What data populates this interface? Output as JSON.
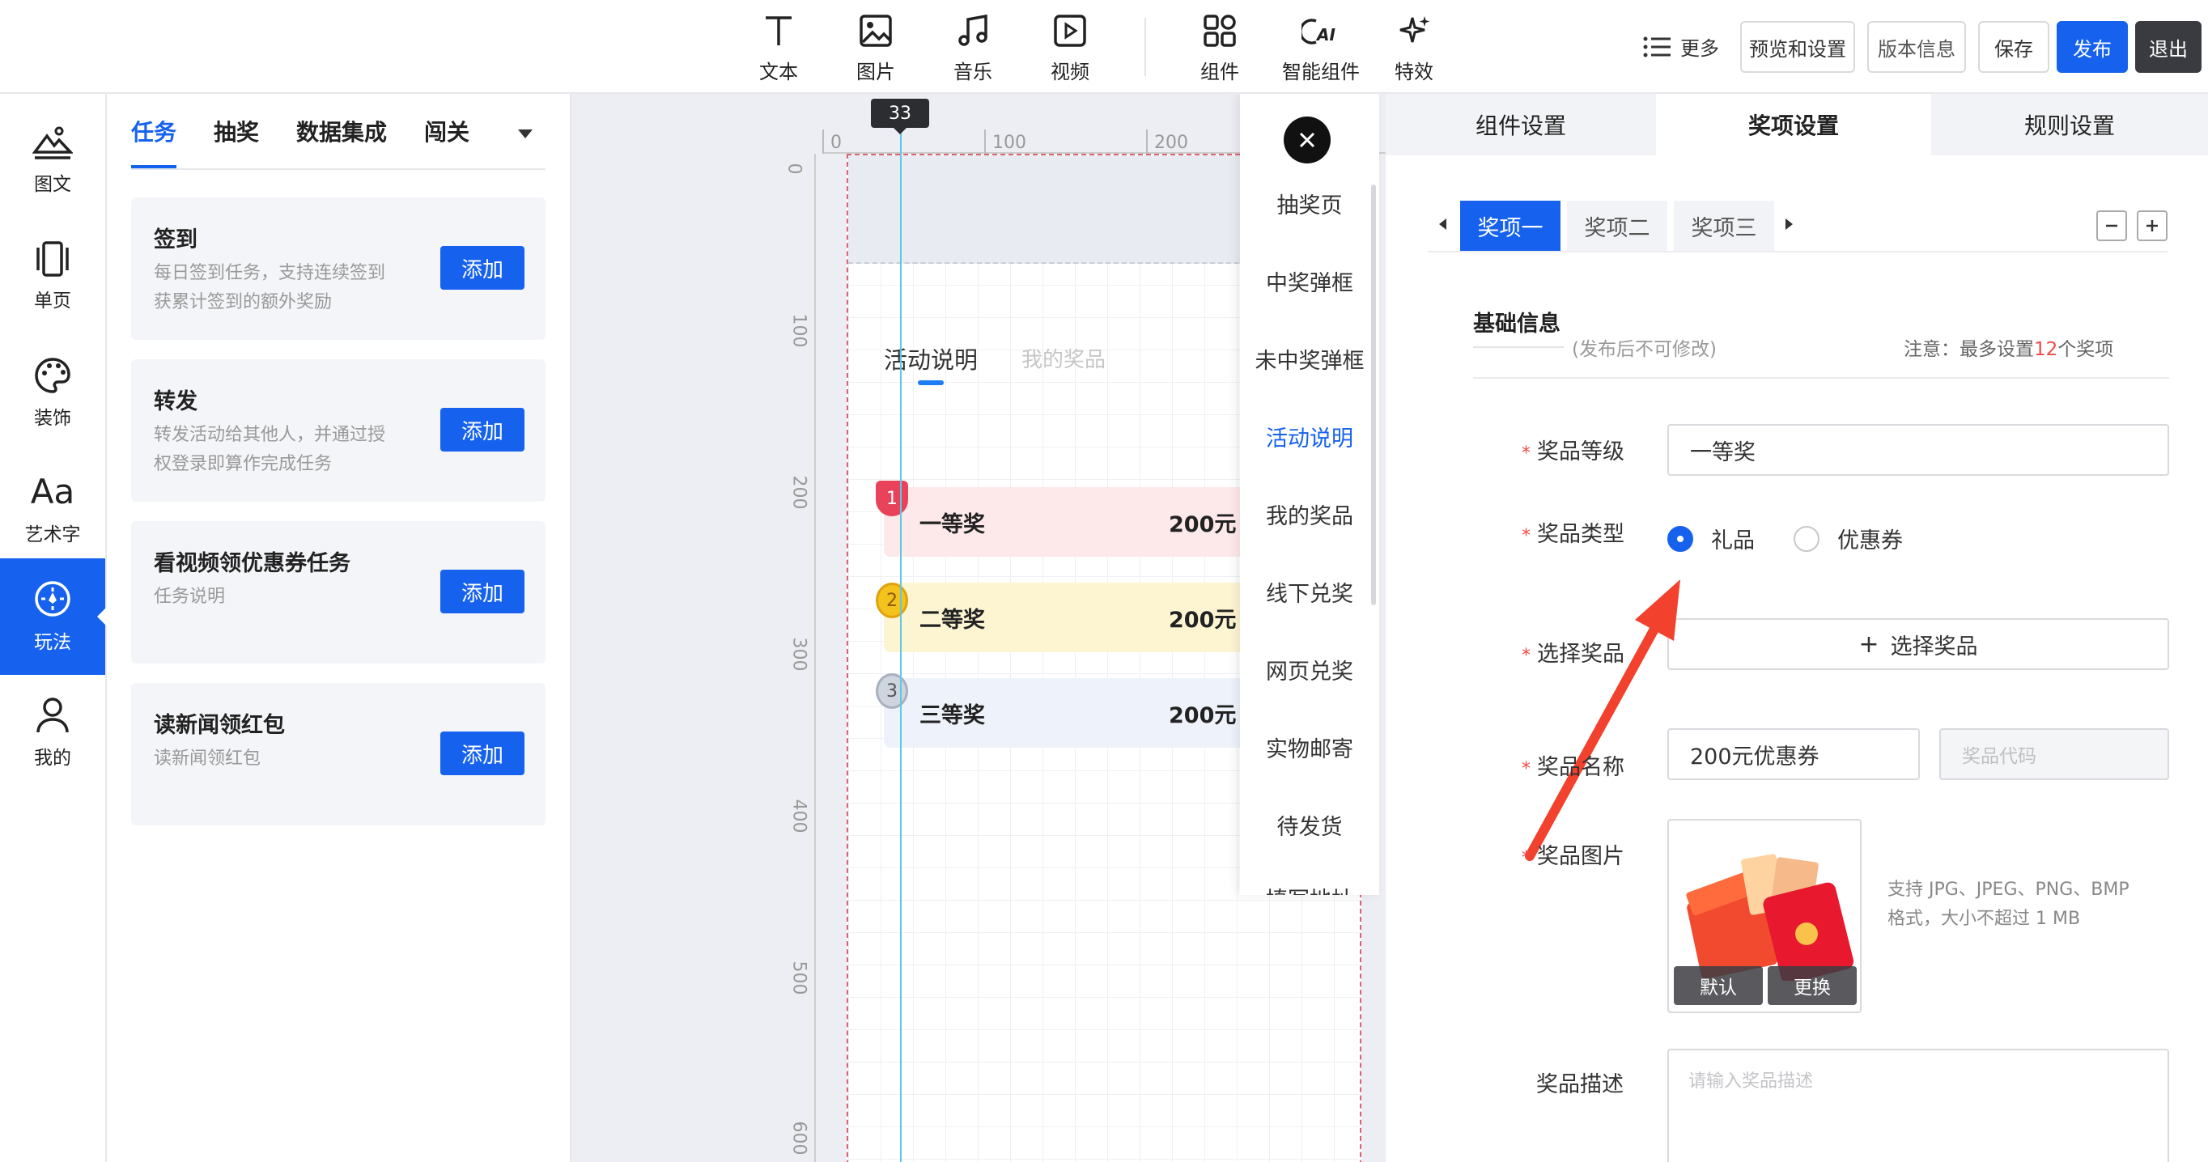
{
  "toolbar": {
    "tools": [
      {
        "label": "文本",
        "icon": "text-icon"
      },
      {
        "label": "图片",
        "icon": "image-icon"
      },
      {
        "label": "音乐",
        "icon": "music-icon"
      },
      {
        "label": "视频",
        "icon": "video-icon"
      },
      {
        "label": "组件",
        "icon": "components-icon"
      },
      {
        "label": "智能组件",
        "icon": "ai-icon"
      },
      {
        "label": "特效",
        "icon": "sparkle-icon"
      }
    ],
    "more_label": "更多",
    "preview_label": "预览和设置",
    "version_label": "版本信息",
    "save_label": "保存",
    "publish_label": "发布",
    "exit_label": "退出",
    "accent": "#1662ee"
  },
  "rail": {
    "items": [
      {
        "label": "图文",
        "icon": "mountain-icon"
      },
      {
        "label": "单页",
        "icon": "page-icon"
      },
      {
        "label": "装饰",
        "icon": "palette-icon"
      },
      {
        "label": "艺术字",
        "icon": "art-text-icon"
      },
      {
        "label": "玩法",
        "icon": "compass-icon"
      },
      {
        "label": "我的",
        "icon": "user-icon"
      }
    ],
    "active_index": 4,
    "art_glyph": "Aa"
  },
  "task_panel": {
    "tabs": [
      "任务",
      "抽奖",
      "数据集成",
      "闯关"
    ],
    "active_tab": 0,
    "cards": [
      {
        "title": "签到",
        "desc": "每日签到任务，支持连续签到获累计签到的额外奖励",
        "button": "添加"
      },
      {
        "title": "转发",
        "desc": "转发活动给其他人，并通过授权登录即算作完成任务",
        "button": "添加"
      },
      {
        "title": "看视频领优惠券任务",
        "desc": "任务说明",
        "button": "添加"
      },
      {
        "title": "读新闻领红包",
        "desc": "读新闻领红包",
        "button": "添加"
      }
    ]
  },
  "canvas": {
    "guide_value": "33",
    "ruler_top": [
      "0",
      "100",
      "200"
    ],
    "ruler_left": [
      "0",
      "100",
      "200",
      "300",
      "400",
      "500",
      "600"
    ],
    "tabs": [
      "活动说明",
      "我的奖品"
    ],
    "prizes": [
      {
        "rank": "1",
        "name": "一等奖",
        "value": "200元",
        "color": "#fde9e9"
      },
      {
        "rank": "2",
        "name": "二等奖",
        "value": "200元",
        "color": "#fdf4d2"
      },
      {
        "rank": "3",
        "name": "三等奖",
        "value": "200元",
        "color": "#eef2fa"
      }
    ]
  },
  "page_nav": {
    "items": [
      "抽奖页",
      "中奖弹框",
      "未中奖弹框",
      "活动说明",
      "我的奖品",
      "线下兑奖",
      "网页兑奖",
      "实物邮寄",
      "待发货",
      "填写地址"
    ],
    "active_index": 3
  },
  "right_panel": {
    "tabs": [
      "组件设置",
      "奖项设置",
      "规则设置"
    ],
    "active_tab": 1,
    "prize_tabs": [
      "奖项一",
      "奖项二",
      "奖项三"
    ],
    "active_prize": 0,
    "section_title": "基础信息",
    "section_sub": "(发布后不可修改)",
    "note_prefix": "注意：最多设置",
    "note_count": "12",
    "note_suffix": "个奖项",
    "fields": {
      "level_label": "奖品等级",
      "level_value": "一等奖",
      "type_label": "奖品类型",
      "type_options": [
        "礼品",
        "优惠券"
      ],
      "type_selected": 0,
      "select_label": "选择奖品",
      "select_button": "选择奖品",
      "name_label": "奖品名称",
      "name_value": "200元优惠券",
      "code_placeholder": "奖品代码",
      "image_label": "奖品图片",
      "image_default": "默认",
      "image_change": "更换",
      "image_hint": "支持 JPG、JPEG、PNG、BMP 格式，大小不超过 1 MB",
      "desc_label": "奖品描述",
      "desc_placeholder": "请输入奖品描述"
    }
  }
}
